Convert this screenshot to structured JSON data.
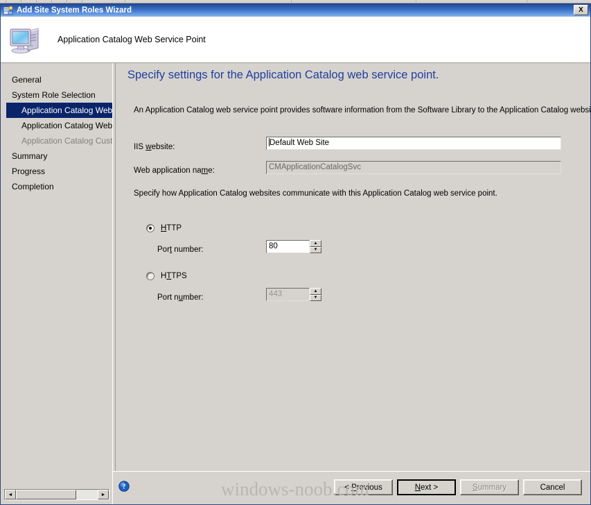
{
  "window": {
    "title": "Add Site System Roles Wizard",
    "title_icon": "wizard-icon",
    "close_label": "X"
  },
  "header": {
    "icon": "computer-icon",
    "title": "Application Catalog Web Service Point"
  },
  "sidebar": {
    "items": [
      {
        "label": "General",
        "state": "normal",
        "indent": false
      },
      {
        "label": "System Role Selection",
        "state": "normal",
        "indent": false
      },
      {
        "label": "Application Catalog Web Se",
        "state": "selected",
        "indent": true
      },
      {
        "label": "Application Catalog Website",
        "state": "normal",
        "indent": true
      },
      {
        "label": "Application Catalog Customi",
        "state": "disabled",
        "indent": true
      },
      {
        "label": "Summary",
        "state": "normal",
        "indent": false
      },
      {
        "label": "Progress",
        "state": "normal",
        "indent": false
      },
      {
        "label": "Completion",
        "state": "normal",
        "indent": false
      }
    ],
    "scrollbar": {
      "left_arrow": "◄",
      "right_arrow": "►"
    }
  },
  "content": {
    "heading": "Specify settings for the Application Catalog web service point.",
    "intro": "An Application Catalog web service point provides software information from the Software Library to the Application Catalog website.",
    "fields": {
      "iis_website": {
        "label_pre": "IIS ",
        "label_accel": "w",
        "label_post": "ebsite:",
        "value": "Default Web Site",
        "enabled": true,
        "focused": true
      },
      "web_app_name": {
        "label_pre": "Web application na",
        "label_accel": "m",
        "label_post": "e:",
        "value": "CMApplicationCatalogSvc",
        "enabled": false,
        "focused": false
      }
    },
    "communication_text": "Specify how Application Catalog websites communicate with this Application Catalog web service point.",
    "protocols": [
      {
        "label_pre": "",
        "label_accel": "H",
        "label_post": "TTP",
        "selected": true,
        "port_label_pre": "Por",
        "port_label_accel": "t",
        "port_label_post": " number:",
        "port_value": "80",
        "port_enabled": true
      },
      {
        "label_pre": "H",
        "label_accel": "T",
        "label_post": "TPS",
        "selected": false,
        "port_label_pre": "Port n",
        "port_label_accel": "u",
        "port_label_post": "mber:",
        "port_value": "443",
        "port_enabled": false
      }
    ],
    "spinner": {
      "up_arrow": "▲",
      "down_arrow": "▼"
    }
  },
  "footer": {
    "help_icon": "help-icon",
    "buttons": [
      {
        "label": "< Previous",
        "accel_index": 3,
        "state": "normal"
      },
      {
        "label": "Next >",
        "accel_index": 0,
        "state": "default"
      },
      {
        "label": "Summary",
        "accel_index": 0,
        "state": "disabled"
      },
      {
        "label": "Cancel",
        "accel_index": -1,
        "state": "normal"
      }
    ]
  },
  "watermark": "windows-noob.com",
  "colors": {
    "title_bar": "#1e3f8f",
    "heading": "#1f3f9e",
    "selection": "#0a246a",
    "face": "#d6d3ce",
    "disabled_text": "#848078"
  }
}
